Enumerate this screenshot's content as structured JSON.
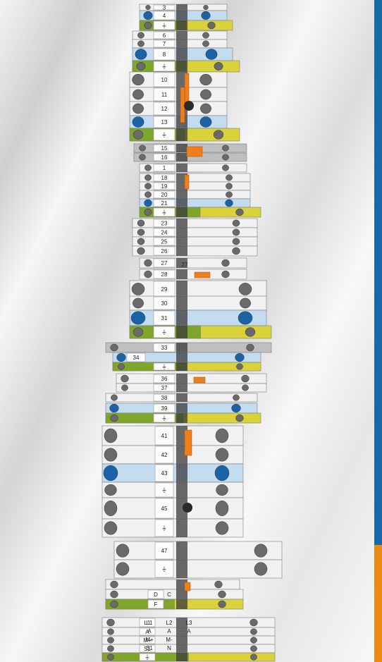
{
  "colors": {
    "blue": "#1b63a6",
    "lightblue": "#a6cfee",
    "green": "#7fa52b",
    "yellow": "#d9d23a",
    "gray": "#9a9a9a",
    "white": "#f1f1f1",
    "orange": "#ee7f1c",
    "dark": "#2a2a2a",
    "edge_blue": "#1769a8",
    "edge_orange": "#ee8a12"
  },
  "ground_symbol": "⏚",
  "terminal_labels": [
    "3",
    "4",
    "6",
    "7",
    "8",
    "10",
    "11",
    "12",
    "13",
    "15",
    "16",
    "1",
    "18",
    "19",
    "20",
    "21",
    "23",
    "24",
    "25",
    "26",
    "27",
    "27",
    "28",
    "29",
    "30",
    "31",
    "33",
    "34",
    "36",
    "37",
    "38",
    "39",
    "41",
    "42",
    "43",
    "45",
    "47",
    "D",
    "C",
    "F",
    "L1",
    "L2",
    "L3",
    "A",
    "A",
    "A",
    "M+",
    "M-",
    "S1",
    "N"
  ]
}
